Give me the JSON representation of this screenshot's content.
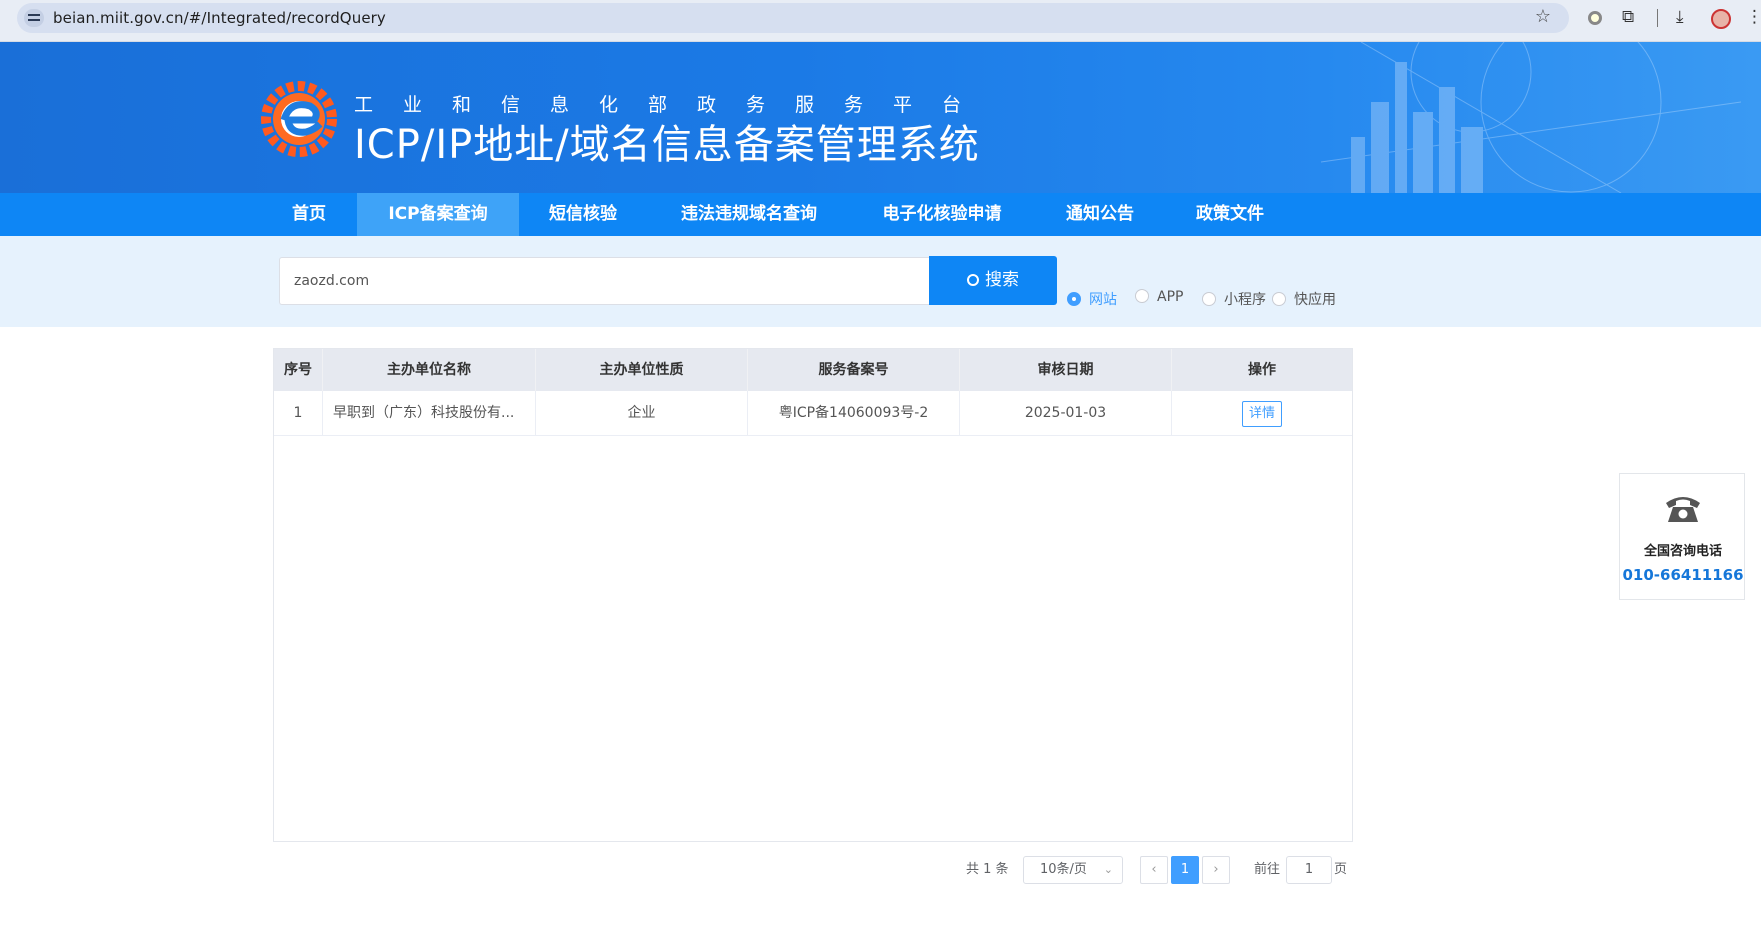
{
  "browser": {
    "url": "beian.miit.gov.cn/#/Integrated/recordQuery"
  },
  "header": {
    "platform_name": "工业和信息化部政务服务平台",
    "system_name": "ICP/IP地址/域名信息备案管理系统"
  },
  "nav": {
    "items": [
      {
        "label": "首页",
        "active": false
      },
      {
        "label": "ICP备案查询",
        "active": true
      },
      {
        "label": "短信核验",
        "active": false
      },
      {
        "label": "违法违规域名查询",
        "active": false
      },
      {
        "label": "电子化核验申请",
        "active": false
      },
      {
        "label": "通知公告",
        "active": false
      },
      {
        "label": "政策文件",
        "active": false
      }
    ]
  },
  "search": {
    "value": "zaozd.com",
    "button_label": "搜索",
    "types": [
      {
        "label": "网站",
        "checked": true
      },
      {
        "label": "APP",
        "checked": false
      },
      {
        "label": "小程序",
        "checked": false
      },
      {
        "label": "快应用",
        "checked": false
      }
    ]
  },
  "table": {
    "columns": [
      "序号",
      "主办单位名称",
      "主办单位性质",
      "服务备案号",
      "审核日期",
      "操作"
    ],
    "rows": [
      {
        "index": "1",
        "org_name": "早职到（广东）科技股份有...",
        "org_type": "企业",
        "record_no": "粤ICP备14060093号-2",
        "audit_date": "2025-01-03",
        "action": "详情"
      }
    ]
  },
  "pagination": {
    "total_text": "共 1 条",
    "page_size": "10条/页",
    "current_page": "1",
    "goto_prefix": "前往",
    "goto_value": "1",
    "goto_suffix": "页"
  },
  "help": {
    "label": "全国咨询电话",
    "phone": "010-66411166"
  },
  "colors": {
    "nav_blue": "#0e86f5",
    "accent": "#409eff"
  }
}
